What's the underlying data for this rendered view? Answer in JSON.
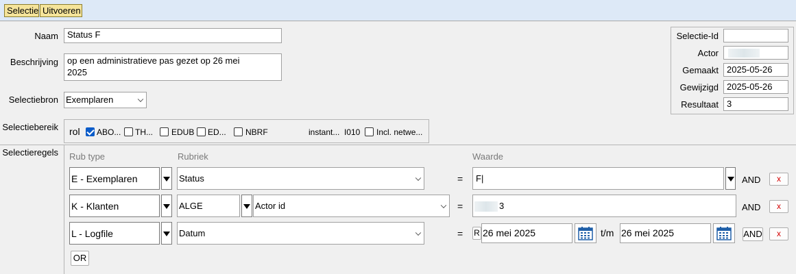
{
  "toolbar": {
    "selectie": "Selectie",
    "uitvoeren": "Uitvoeren"
  },
  "form": {
    "naam_label": "Naam",
    "naam_value": "Status F",
    "beschrijving_label": "Beschrijving",
    "beschrijving_line1": "op een administratieve pas gezet op 26 mei",
    "beschrijving_line2": "2025",
    "selectiebron_label": "Selectiebron",
    "selectiebron_value": "Exemplaren",
    "selectiebereik_label": "Selectiebereik",
    "selectieregels_label": "Selectieregels"
  },
  "info": {
    "selectie_id_label": "Selectie-Id",
    "selectie_id_value": "",
    "actor_label": "Actor",
    "gemaakt_label": "Gemaakt",
    "gemaakt_value": "2025-05-26",
    "gewijzigd_label": "Gewijzigd",
    "gewijzigd_value": "2025-05-26",
    "resultaat_label": "Resultaat",
    "resultaat_value": "3"
  },
  "bereik": {
    "rol": "rol",
    "items": [
      {
        "label": "ABO...",
        "checked": true
      },
      {
        "label": "TH...",
        "checked": false
      },
      {
        "label": "EDUB",
        "checked": false
      },
      {
        "label": "ED...",
        "checked": false
      },
      {
        "label": "NBRF",
        "checked": false
      }
    ],
    "instant": "instant...",
    "code": "I010",
    "incl": "Incl. netwe..."
  },
  "rules": {
    "headers": {
      "rub_type": "Rub type",
      "rubriek": "Rubriek",
      "waarde": "Waarde"
    },
    "rows": [
      {
        "type": "E - Exemplaren",
        "rubriek": "Status",
        "eq": "=",
        "value": "F|",
        "and": "AND",
        "x": "x"
      },
      {
        "type": "K - Klanten",
        "sub": "ALGE",
        "rubriek": "Actor id",
        "eq": "=",
        "value_suffix": "3",
        "and": "AND",
        "x": "x"
      },
      {
        "type": "L - Logfile",
        "rubriek": "Datum",
        "eq": "=",
        "r": "R",
        "from": "26 mei 2025",
        "tm": "t/m",
        "to": "26 mei 2025",
        "and": "AND",
        "x": "x"
      }
    ],
    "or": "OR"
  }
}
